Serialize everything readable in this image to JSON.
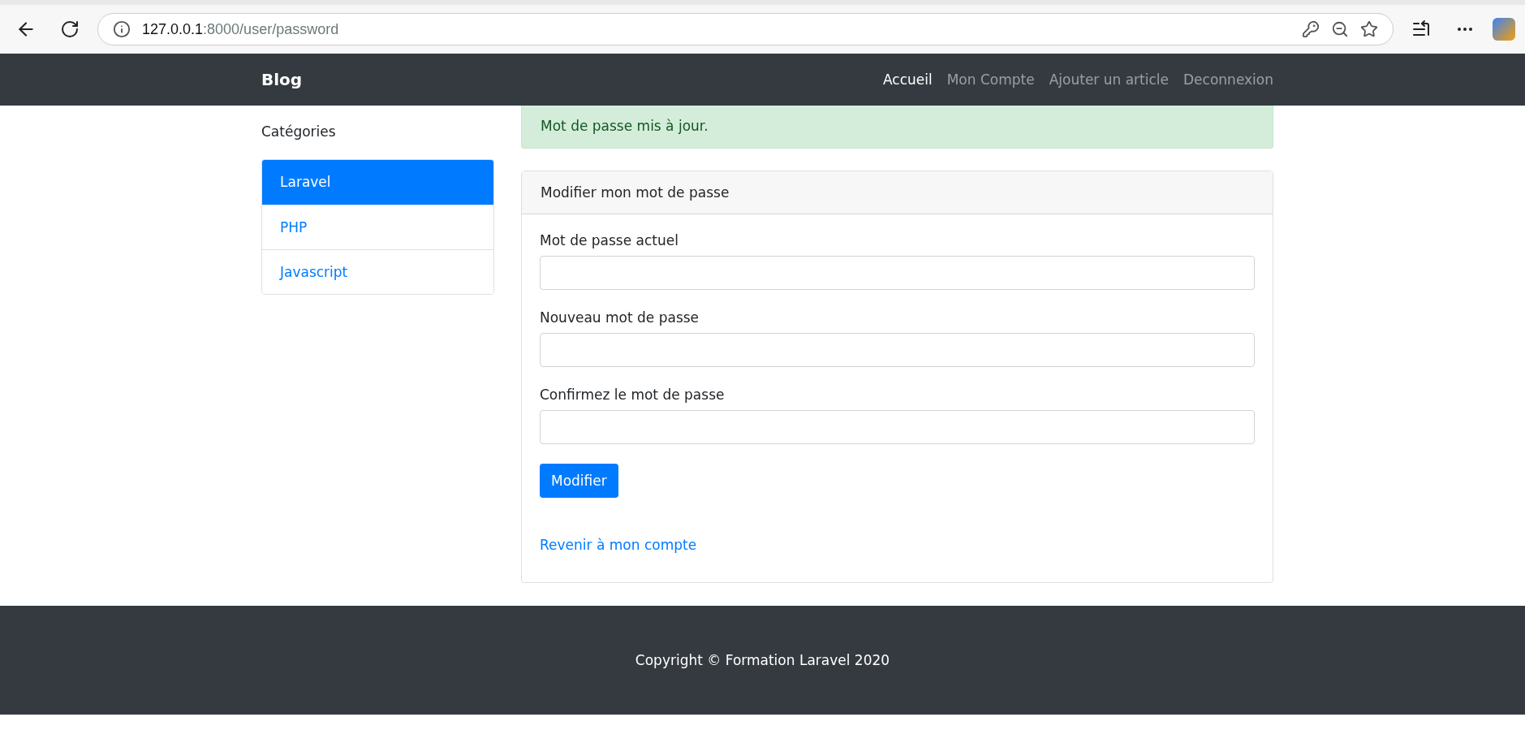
{
  "browser": {
    "url_host": "127.0.0.1",
    "url_path": ":8000/user/password"
  },
  "navbar": {
    "brand": "Blog",
    "links": [
      {
        "label": "Accueil",
        "selected": true
      },
      {
        "label": "Mon Compte",
        "selected": false
      },
      {
        "label": "Ajouter un article",
        "selected": false
      },
      {
        "label": "Deconnexion",
        "selected": false
      }
    ]
  },
  "sidebar": {
    "title": "Catégories",
    "items": [
      {
        "label": "Laravel",
        "selected": true
      },
      {
        "label": "PHP",
        "selected": false
      },
      {
        "label": "Javascript",
        "selected": false
      }
    ]
  },
  "alert": {
    "text": "Mot de passe mis à jour."
  },
  "card": {
    "header": "Modifier mon mot de passe",
    "fields": [
      {
        "label": "Mot de passe actuel"
      },
      {
        "label": "Nouveau mot de passe"
      },
      {
        "label": "Confirmez le mot de passe"
      }
    ],
    "submit": "Modifier",
    "back_link": "Revenir à mon compte"
  },
  "footer": {
    "text": "Copyright © Formation Laravel 2020"
  }
}
